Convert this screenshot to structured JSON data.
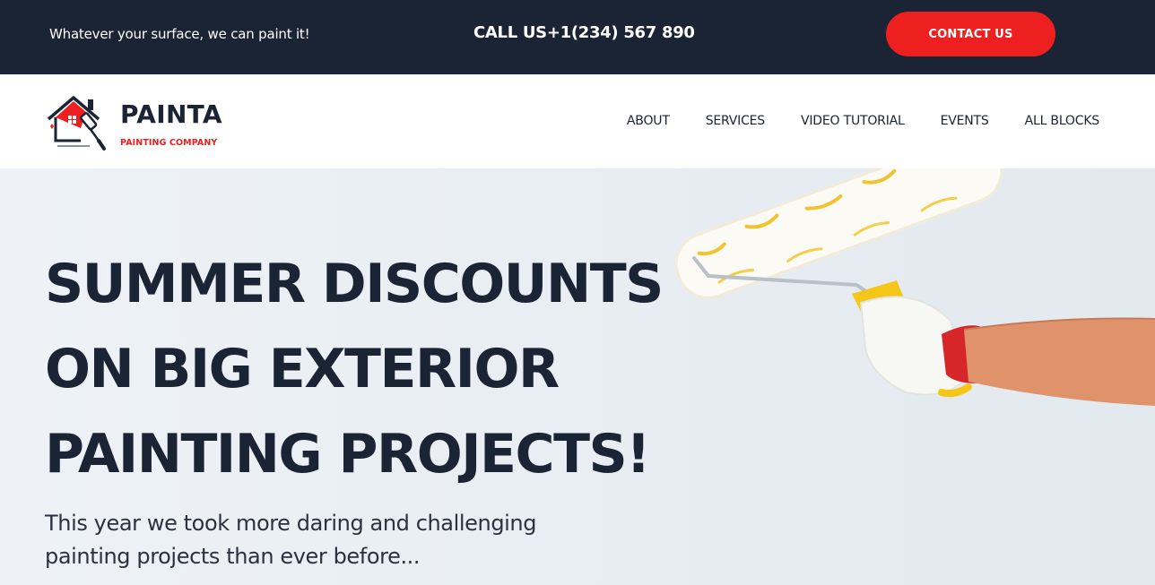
{
  "topbar": {
    "tagline": "Whatever your surface, we can paint it!",
    "phone": "CALL US+1(234) 567 890",
    "contact_label": "CONTACT US"
  },
  "logo": {
    "name": "PAINTA",
    "subtitle": "PAINTING COMPANY",
    "icon": "house-paint-roller-icon"
  },
  "nav": {
    "items": [
      {
        "label": "ABOUT"
      },
      {
        "label": "SERVICES"
      },
      {
        "label": "VIDEO TUTORIAL"
      },
      {
        "label": "EVENTS"
      },
      {
        "label": "ALL BLOCKS"
      }
    ]
  },
  "hero": {
    "headline_lines": [
      "SUMMER DISCOUNTS",
      "ON BIG EXTERIOR",
      "PAINTING PROJECTS!"
    ],
    "subtext_lines": [
      "This year we took more daring and challenging",
      "painting projects than ever before..."
    ]
  },
  "colors": {
    "dark": "#1b2434",
    "accent": "#ee1f1f",
    "hero_bg": "#e9eef3"
  }
}
